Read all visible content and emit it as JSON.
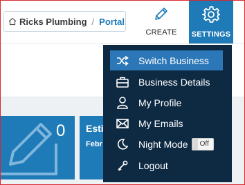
{
  "breadcrumb": {
    "business": "Ricks Plumbing",
    "separator": "/",
    "current": "Portal"
  },
  "header": {
    "create_label": "CREATE",
    "settings_label": "SETTINGS"
  },
  "tiles": [
    {
      "count": "0"
    },
    {
      "title": "Esti",
      "subtitle": "Febr"
    }
  ],
  "menu": {
    "items": [
      {
        "label": "Switch Business",
        "icon": "shuffle-icon",
        "active": true
      },
      {
        "label": "Business Details",
        "icon": "briefcase-icon"
      },
      {
        "label": "My Profile",
        "icon": "user-icon"
      },
      {
        "label": "My Emails",
        "icon": "envelope-icon"
      },
      {
        "label": "Night Mode",
        "icon": "moon-icon",
        "toggle": "Off"
      },
      {
        "label": "Logout",
        "icon": "key-icon"
      }
    ]
  },
  "colors": {
    "accent": "#1f7ab8",
    "menu_bg": "#0e2a43",
    "menu_active": "#2c77b8",
    "frame_border": "#d8282f"
  }
}
